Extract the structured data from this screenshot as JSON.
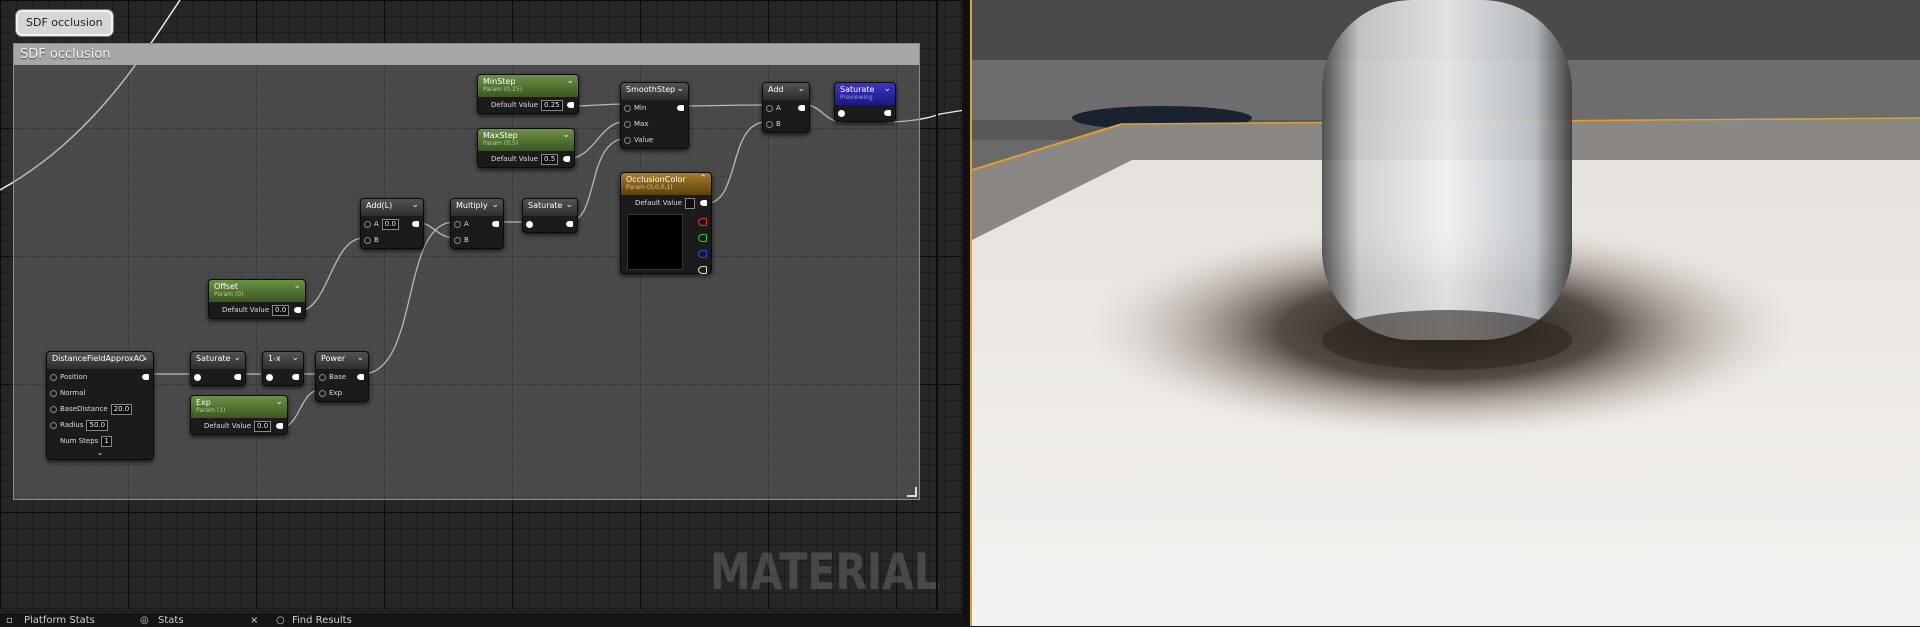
{
  "comment": {
    "bubble_label": "SDF occlusion",
    "box_title": "SDF occlusion"
  },
  "watermark": "MATERIAL",
  "nodes": {
    "minstep": {
      "title": "MinStep",
      "subtitle": "Param (0.25)",
      "field_label": "Default Value",
      "value": "0.25"
    },
    "maxstep": {
      "title": "MaxStep",
      "subtitle": "Param (0.5)",
      "field_label": "Default Value",
      "value": "0.5"
    },
    "smoothstep": {
      "title": "SmoothStep",
      "pins": [
        "Min",
        "Max",
        "Value"
      ]
    },
    "add": {
      "title": "Add",
      "pins": [
        "A",
        "B"
      ]
    },
    "saturate_preview": {
      "title": "Saturate",
      "subtitle": "Previewing"
    },
    "occlusioncolor": {
      "title": "OcclusionColor",
      "subtitle": "Param (0,0,0,1)",
      "field_label": "Default Value"
    },
    "add_l": {
      "title": "Add(L)",
      "pin_a": "A",
      "pin_a_value": "0.0",
      "pin_b": "B"
    },
    "multiply": {
      "title": "Multiply",
      "pins": [
        "A",
        "B"
      ]
    },
    "saturate_mid": {
      "title": "Saturate"
    },
    "offset": {
      "title": "Offset",
      "subtitle": "Param (0)",
      "field_label": "Default Value",
      "value": "0.0"
    },
    "dfao": {
      "title": "DistanceFieldApproxAO",
      "position": "Position",
      "normal": "Normal",
      "basedistance_label": "BaseDistance",
      "basedistance": "20.0",
      "radius_label": "Radius",
      "radius": "50.0",
      "numsteps_label": "Num Steps",
      "numsteps": "1"
    },
    "saturate_low": {
      "title": "Saturate"
    },
    "one_minus": {
      "title": "1-x"
    },
    "power": {
      "title": "Power",
      "pins": [
        "Base",
        "Exp"
      ]
    },
    "exp": {
      "title": "Exp",
      "subtitle": "Param (1)",
      "field_label": "Default Value",
      "value": "0.0"
    }
  },
  "statusbar": {
    "platform_stats": "Platform Stats",
    "stats": "Stats",
    "find_results": "Find Results"
  },
  "colors": {
    "accent_orange": "#e0a030",
    "param_header": "#5a7d38",
    "vector_header": "#8a6620",
    "preview_header": "#2c27a8"
  }
}
